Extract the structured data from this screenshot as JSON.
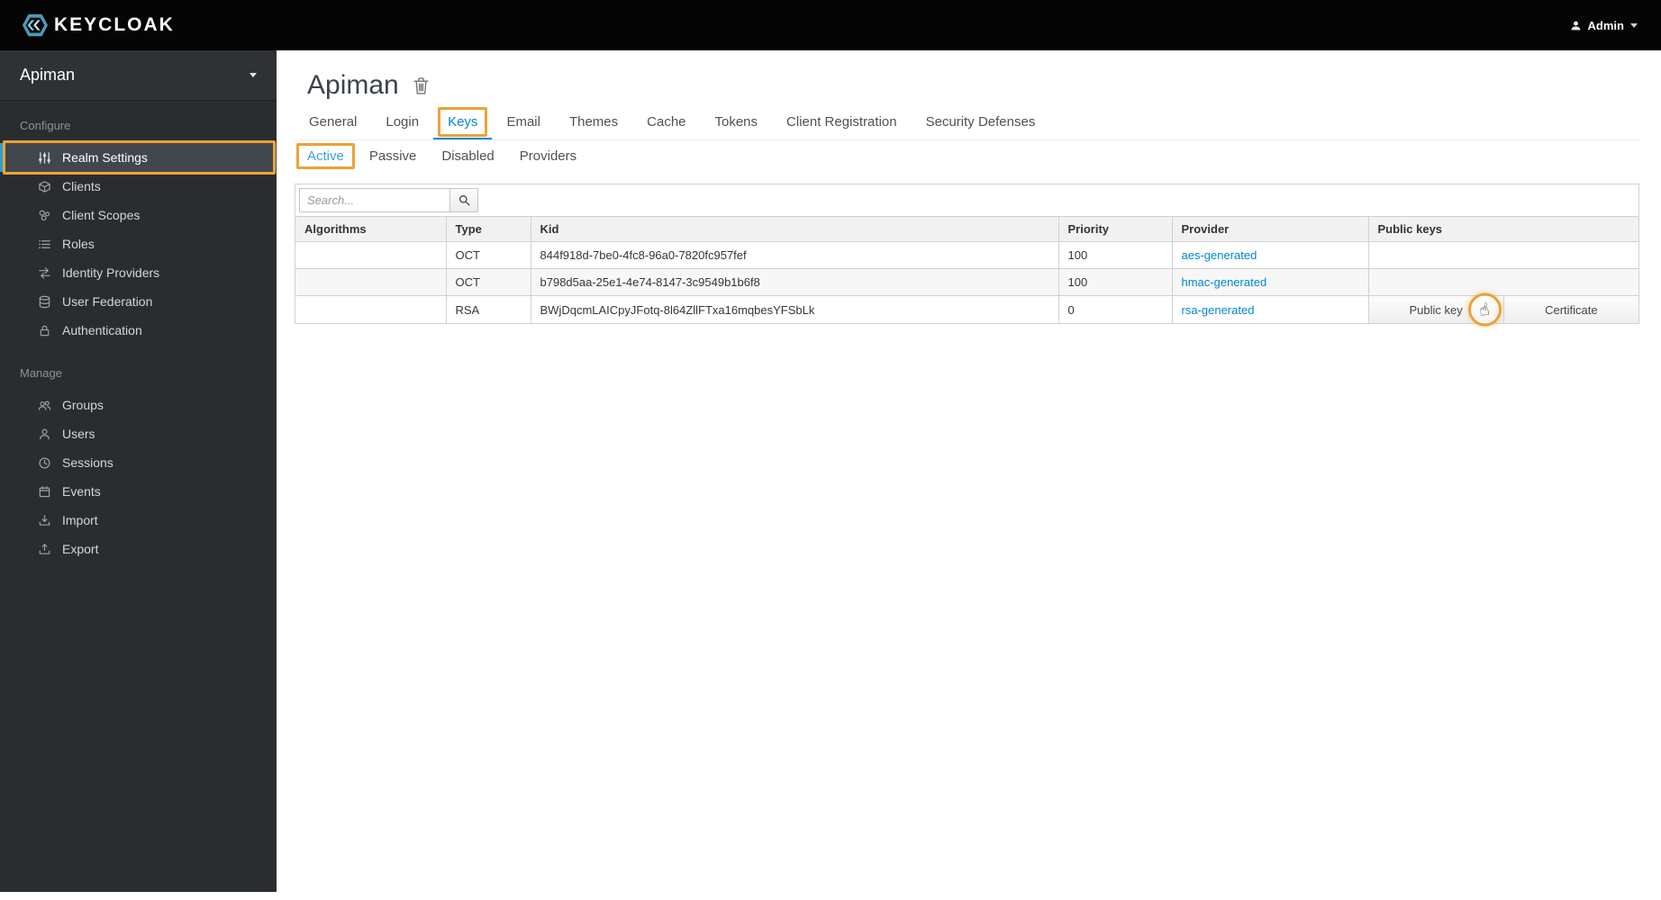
{
  "colors": {
    "annotation_orange": "#eba236",
    "link_blue": "#0088ce",
    "active_subtab_blue": "#39a5dc",
    "sidebar_bg": "#2a2d30",
    "topbar_bg": "#050505"
  },
  "topbar": {
    "brand": "KEYCLOAK",
    "user": "Admin"
  },
  "sidebar": {
    "realm": "Apiman",
    "sections": [
      {
        "title": "Configure",
        "items": [
          {
            "label": "Realm Settings",
            "icon": "sliders-icon",
            "active": true
          },
          {
            "label": "Clients",
            "icon": "cube-icon"
          },
          {
            "label": "Client Scopes",
            "icon": "scopes-icon"
          },
          {
            "label": "Roles",
            "icon": "list-icon"
          },
          {
            "label": "Identity Providers",
            "icon": "arrows-icon"
          },
          {
            "label": "User Federation",
            "icon": "database-icon"
          },
          {
            "label": "Authentication",
            "icon": "lock-icon"
          }
        ]
      },
      {
        "title": "Manage",
        "items": [
          {
            "label": "Groups",
            "icon": "users-icon"
          },
          {
            "label": "Users",
            "icon": "user-icon"
          },
          {
            "label": "Sessions",
            "icon": "clock-icon"
          },
          {
            "label": "Events",
            "icon": "calendar-icon"
          },
          {
            "label": "Import",
            "icon": "import-icon"
          },
          {
            "label": "Export",
            "icon": "export-icon"
          }
        ]
      }
    ]
  },
  "page": {
    "title": "Apiman"
  },
  "tabs": [
    "General",
    "Login",
    "Keys",
    "Email",
    "Themes",
    "Cache",
    "Tokens",
    "Client Registration",
    "Security Defenses"
  ],
  "active_tab": "Keys",
  "subtabs": [
    "Active",
    "Passive",
    "Disabled",
    "Providers"
  ],
  "active_subtab": "Active",
  "table": {
    "search_placeholder": "Search...",
    "columns": [
      "Algorithms",
      "Type",
      "Kid",
      "Priority",
      "Provider",
      "Public keys"
    ],
    "rows": [
      {
        "algorithms": "",
        "type": "OCT",
        "kid": "844f918d-7be0-4fc8-96a0-7820fc957fef",
        "priority": "100",
        "provider": "aes-generated"
      },
      {
        "algorithms": "",
        "type": "OCT",
        "kid": "b798d5aa-25e1-4e74-8147-3c9549b1b6f8",
        "priority": "100",
        "provider": "hmac-generated"
      },
      {
        "algorithms": "",
        "type": "RSA",
        "kid": "BWjDqcmLAICpyJFotq-8l64ZllFTxa16mqbesYFSbLk",
        "priority": "0",
        "provider": "rsa-generated",
        "actions": [
          "Public key",
          "Certificate"
        ]
      }
    ]
  }
}
